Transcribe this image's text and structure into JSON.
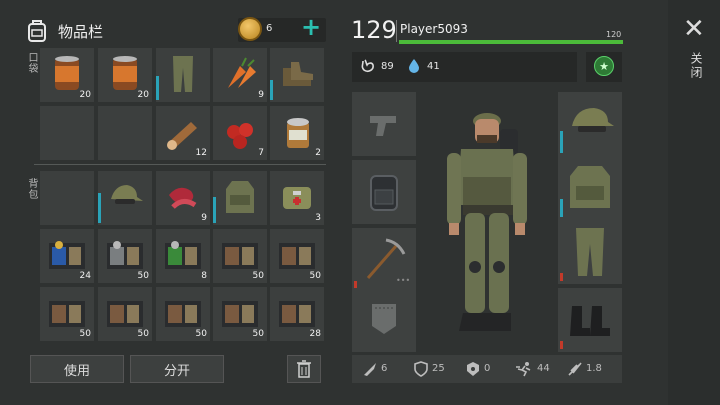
{
  "header": {
    "title": "物品栏",
    "coins": "6",
    "plus": "+"
  },
  "sections": {
    "pockets": "口袋",
    "backpack": "背包"
  },
  "pocket_slots": [
    {
      "item": "canned-food-icon",
      "count": "20"
    },
    {
      "item": "canned-food-icon",
      "count": "20"
    },
    {
      "item": "camo-pants-icon",
      "count": ""
    },
    {
      "item": "carrot-icon",
      "count": "9"
    },
    {
      "item": "boots-icon",
      "count": ""
    },
    {
      "item": "",
      "count": ""
    },
    {
      "item": "",
      "count": ""
    },
    {
      "item": "log-icon",
      "count": "12"
    },
    {
      "item": "berries-icon",
      "count": "7"
    },
    {
      "item": "open-can-icon",
      "count": "2"
    }
  ],
  "backpack_slots": [
    {
      "item": "",
      "count": ""
    },
    {
      "item": "camo-cap-icon",
      "count": ""
    },
    {
      "item": "raw-meat-icon",
      "count": "9"
    },
    {
      "item": "camo-vest-icon",
      "count": ""
    },
    {
      "item": "medkit-bag-icon",
      "count": "3"
    },
    {
      "item": "blue-card-icon",
      "count": "24"
    },
    {
      "item": "gray-card-icon",
      "count": "50"
    },
    {
      "item": "green-card-icon",
      "count": "8"
    },
    {
      "item": "notebook-icon",
      "count": "50"
    },
    {
      "item": "notebook-icon",
      "count": "50"
    },
    {
      "item": "notebook-icon",
      "count": "50"
    },
    {
      "item": "notebook-icon",
      "count": "50"
    },
    {
      "item": "notebook-icon",
      "count": "50"
    },
    {
      "item": "notebook-icon",
      "count": "50"
    },
    {
      "item": "notebook-icon",
      "count": "28"
    }
  ],
  "buttons": {
    "use": "使用",
    "split": "分开"
  },
  "player": {
    "level": "129",
    "name": "Player5093",
    "xp_label": "120",
    "xp_progress": 1.0,
    "hunger": "89",
    "thirst": "41"
  },
  "equipment": {
    "left": [
      "pistol-slot-icon",
      "backpack-slot-icon",
      "pickaxe-slot-icon",
      "pocket-slot-icon"
    ],
    "right": [
      "camo-cap-icon",
      "camo-vest-icon",
      "camo-pants-icon",
      "boots-icon"
    ]
  },
  "stats": {
    "attack": "6",
    "armor": "25",
    "radiation": "0",
    "speed": "44",
    "weight": "1.8"
  },
  "close": {
    "label": "关闭"
  },
  "colors": {
    "accent": "#2bbfb0",
    "xp": "#4cbb3a",
    "durability": "#2aa3b8"
  }
}
